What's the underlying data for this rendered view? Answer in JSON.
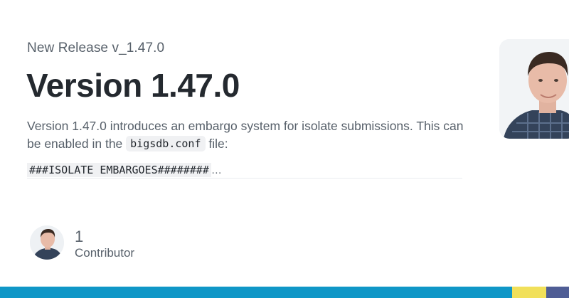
{
  "release": {
    "kicker": "New Release v_1.47.0",
    "title": "Version 1.47.0",
    "description_before": "Version 1.47.0 introduces an embargo system for isolate submissions. This can be enabled in the ",
    "config_file": "bigsdb.conf",
    "description_after": " file:",
    "code_snippet": "###ISOLATE EMBARGOES########",
    "truncation": "…"
  },
  "contributors": {
    "count": "1",
    "label": "Contributor"
  },
  "language_bar": [
    {
      "color": "#0f97c7",
      "share": 0.9
    },
    {
      "color": "#f1e05a",
      "share": 0.06
    },
    {
      "color": "#4f5d95",
      "share": 0.04
    }
  ]
}
